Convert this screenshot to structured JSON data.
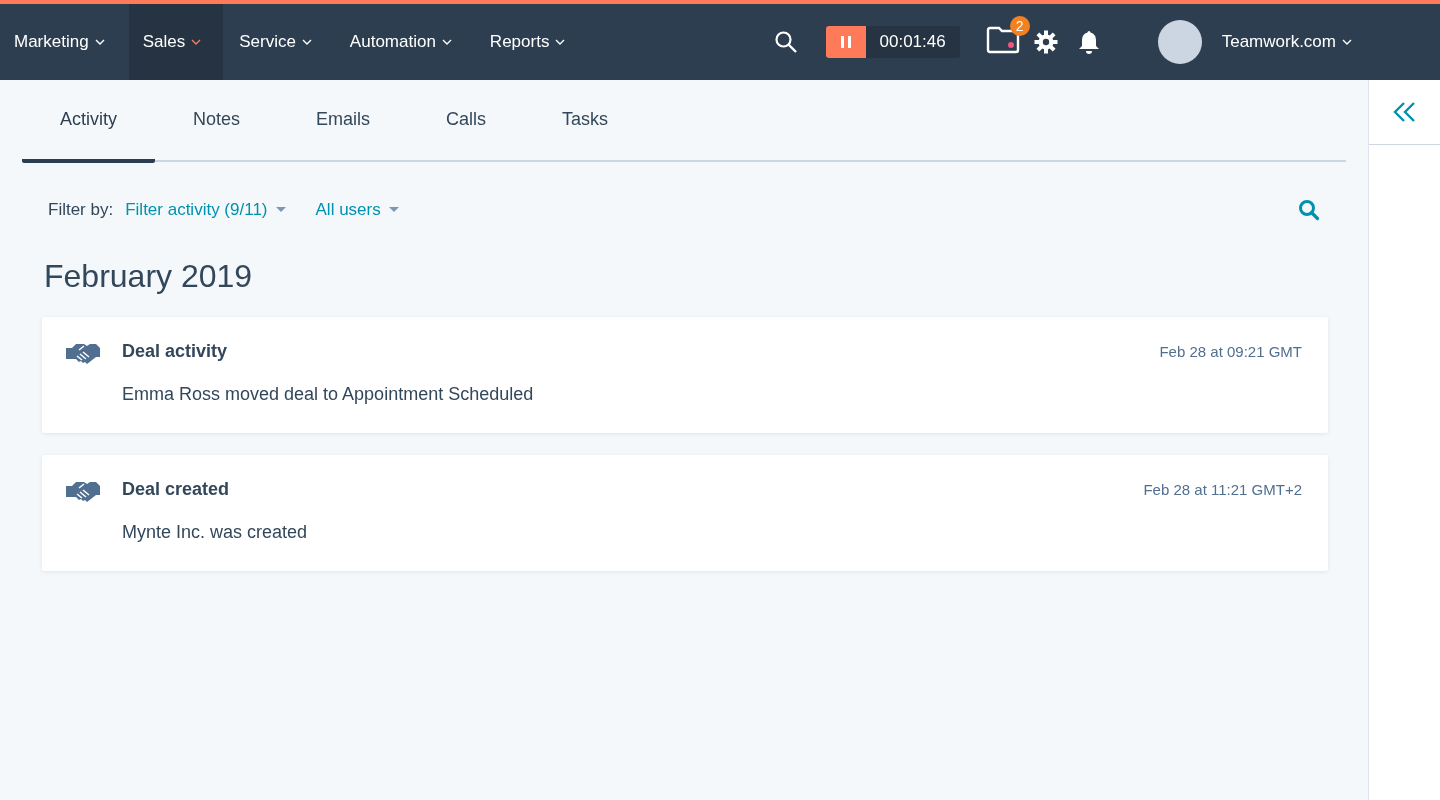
{
  "nav": {
    "items": [
      {
        "label": "Marketing",
        "selected": false
      },
      {
        "label": "Sales",
        "selected": true
      },
      {
        "label": "Service",
        "selected": false
      },
      {
        "label": "Automation",
        "selected": false
      },
      {
        "label": "Reports",
        "selected": false
      }
    ],
    "timer": "00:01:46",
    "inbox_badge": "2",
    "account": "Teamwork.com"
  },
  "tabs": [
    {
      "label": "Activity",
      "selected": true
    },
    {
      "label": "Notes",
      "selected": false
    },
    {
      "label": "Emails",
      "selected": false
    },
    {
      "label": "Calls",
      "selected": false
    },
    {
      "label": "Tasks",
      "selected": false
    }
  ],
  "filter": {
    "label": "Filter by:",
    "activity": "Filter activity (9/11)",
    "users": "All users"
  },
  "month": "February 2019",
  "activities": [
    {
      "title": "Deal activity",
      "time": "Feb 28 at 09:21 GMT",
      "body": "Emma Ross moved deal to Appointment Scheduled"
    },
    {
      "title": "Deal created",
      "time": "Feb 28 at 11:21 GMT+2",
      "body": "Mynte Inc. was created"
    }
  ]
}
